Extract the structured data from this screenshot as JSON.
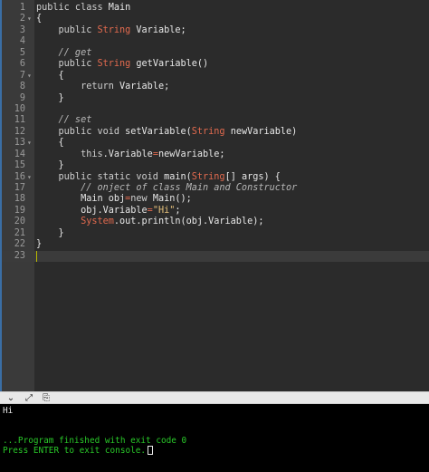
{
  "editor": {
    "lines": [
      {
        "n": "1",
        "fold": "",
        "html_parts": [
          [
            "kw",
            "public class "
          ],
          [
            "type",
            "Main"
          ]
        ]
      },
      {
        "n": "2",
        "fold": "▾",
        "html_parts": [
          [
            "type",
            "{"
          ]
        ]
      },
      {
        "n": "3",
        "fold": "",
        "html_parts": [
          [
            "kw",
            "    public "
          ],
          [
            "str-t",
            "String"
          ],
          [
            "type",
            " Variable;"
          ]
        ]
      },
      {
        "n": "4",
        "fold": "",
        "html_parts": []
      },
      {
        "n": "5",
        "fold": "",
        "html_parts": [
          [
            "cm",
            "    // get"
          ]
        ]
      },
      {
        "n": "6",
        "fold": "",
        "html_parts": [
          [
            "kw",
            "    public "
          ],
          [
            "str-t",
            "String"
          ],
          [
            "type",
            " getVariable()"
          ]
        ]
      },
      {
        "n": "7",
        "fold": "▾",
        "html_parts": [
          [
            "type",
            "    {"
          ]
        ]
      },
      {
        "n": "8",
        "fold": "",
        "html_parts": [
          [
            "kw",
            "        return "
          ],
          [
            "type",
            "Variable;"
          ]
        ]
      },
      {
        "n": "9",
        "fold": "",
        "html_parts": [
          [
            "type",
            "    }"
          ]
        ]
      },
      {
        "n": "10",
        "fold": "",
        "html_parts": []
      },
      {
        "n": "11",
        "fold": "",
        "html_parts": [
          [
            "cm",
            "    // set"
          ]
        ]
      },
      {
        "n": "12",
        "fold": "",
        "html_parts": [
          [
            "kw",
            "    public void "
          ],
          [
            "type",
            "setVariable("
          ],
          [
            "str-t",
            "String"
          ],
          [
            "type",
            " newVariable)"
          ]
        ]
      },
      {
        "n": "13",
        "fold": "▾",
        "html_parts": [
          [
            "type",
            "    {"
          ]
        ]
      },
      {
        "n": "14",
        "fold": "",
        "html_parts": [
          [
            "kw",
            "        this"
          ],
          [
            "type",
            ".Variable"
          ],
          [
            "str-t",
            "="
          ],
          [
            "type",
            "newVariable;"
          ]
        ]
      },
      {
        "n": "15",
        "fold": "",
        "html_parts": [
          [
            "type",
            "    }"
          ]
        ]
      },
      {
        "n": "16",
        "fold": "▾",
        "html_parts": [
          [
            "kw",
            "    public static void "
          ],
          [
            "type",
            "main("
          ],
          [
            "str-t",
            "String"
          ],
          [
            "type",
            "[] args) {"
          ]
        ]
      },
      {
        "n": "17",
        "fold": "",
        "html_parts": [
          [
            "cm",
            "        // onject of class Main and Constructor"
          ]
        ]
      },
      {
        "n": "18",
        "fold": "",
        "html_parts": [
          [
            "type",
            "        Main obj"
          ],
          [
            "str-t",
            "="
          ],
          [
            "kw",
            "new "
          ],
          [
            "type",
            "Main();"
          ]
        ]
      },
      {
        "n": "19",
        "fold": "",
        "html_parts": [
          [
            "type",
            "        obj.Variable"
          ],
          [
            "str-t",
            "="
          ],
          [
            "strlit",
            "\"Hi\""
          ],
          [
            "type",
            ";"
          ]
        ]
      },
      {
        "n": "20",
        "fold": "",
        "html_parts": [
          [
            "sys",
            "        System"
          ],
          [
            "type",
            ".out.println(obj.Variable);"
          ]
        ]
      },
      {
        "n": "21",
        "fold": "",
        "html_parts": [
          [
            "type",
            "    }"
          ]
        ]
      },
      {
        "n": "22",
        "fold": "",
        "html_parts": [
          [
            "type",
            "}"
          ]
        ]
      },
      {
        "n": "23",
        "fold": "",
        "html_parts": []
      }
    ],
    "active_line": "23"
  },
  "toolbar": {
    "icons": [
      {
        "name": "collapse-console-icon",
        "glyph": "⌄"
      },
      {
        "name": "expand-console-icon",
        "glyph": "⤢"
      },
      {
        "name": "copy-output-icon",
        "glyph": "⎘"
      }
    ]
  },
  "console": {
    "output": "Hi",
    "finished": "...Program finished with exit code 0",
    "prompt": "Press ENTER to exit console."
  }
}
